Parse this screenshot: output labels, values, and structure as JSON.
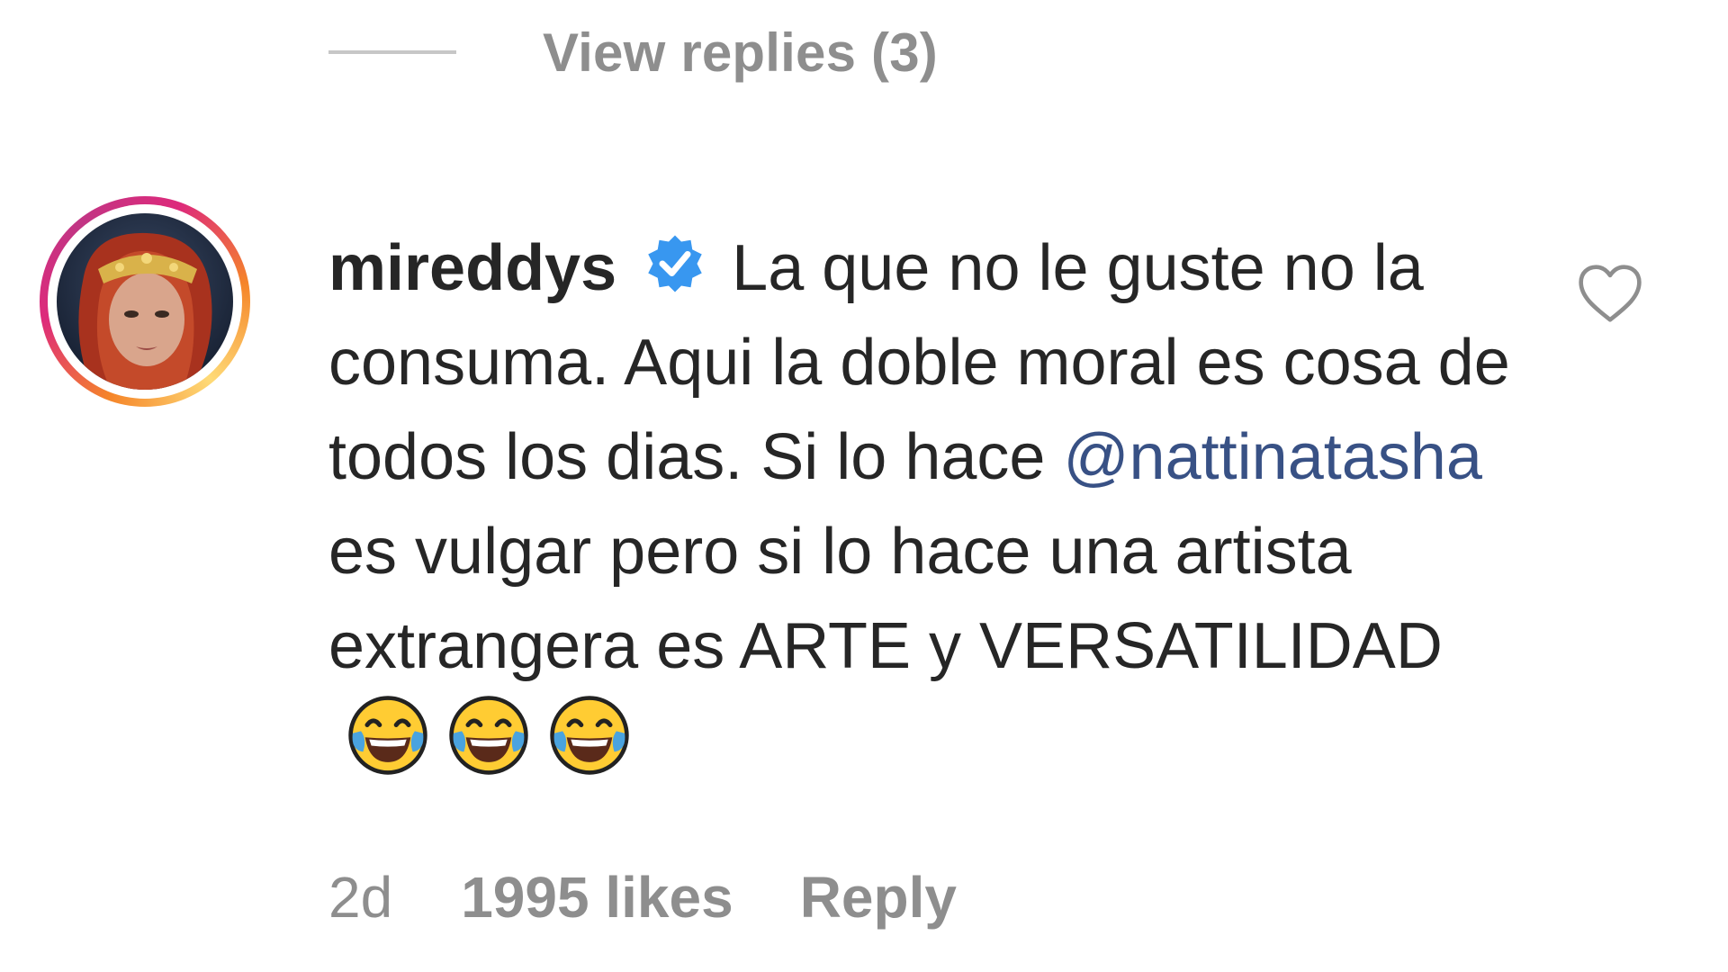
{
  "replies_toggle": {
    "label": "View replies (3)"
  },
  "comment": {
    "avatar_icon": "profile-avatar",
    "username": "mireddys",
    "verified_icon": "verified-badge-icon",
    "verified_color": "#3897f0",
    "text_part1": "La que no le guste no la consuma. Aqui la doble moral es cosa de todos los dias. Si lo hace ",
    "mention": "@nattinatasha",
    "text_part2": " es vulgar pero si lo hace una artista extrangera es ARTE y VERSATILIDAD",
    "emojis": [
      "face-with-tears-of-joy",
      "face-with-tears-of-joy",
      "face-with-tears-of-joy"
    ],
    "like_icon": "heart-icon"
  },
  "meta": {
    "time": "2d",
    "likes": "1995 likes",
    "reply": "Reply"
  },
  "colors": {
    "text": "#262626",
    "secondary": "#8e8e8e",
    "mention": "#385185",
    "verified": "#3897f0"
  }
}
